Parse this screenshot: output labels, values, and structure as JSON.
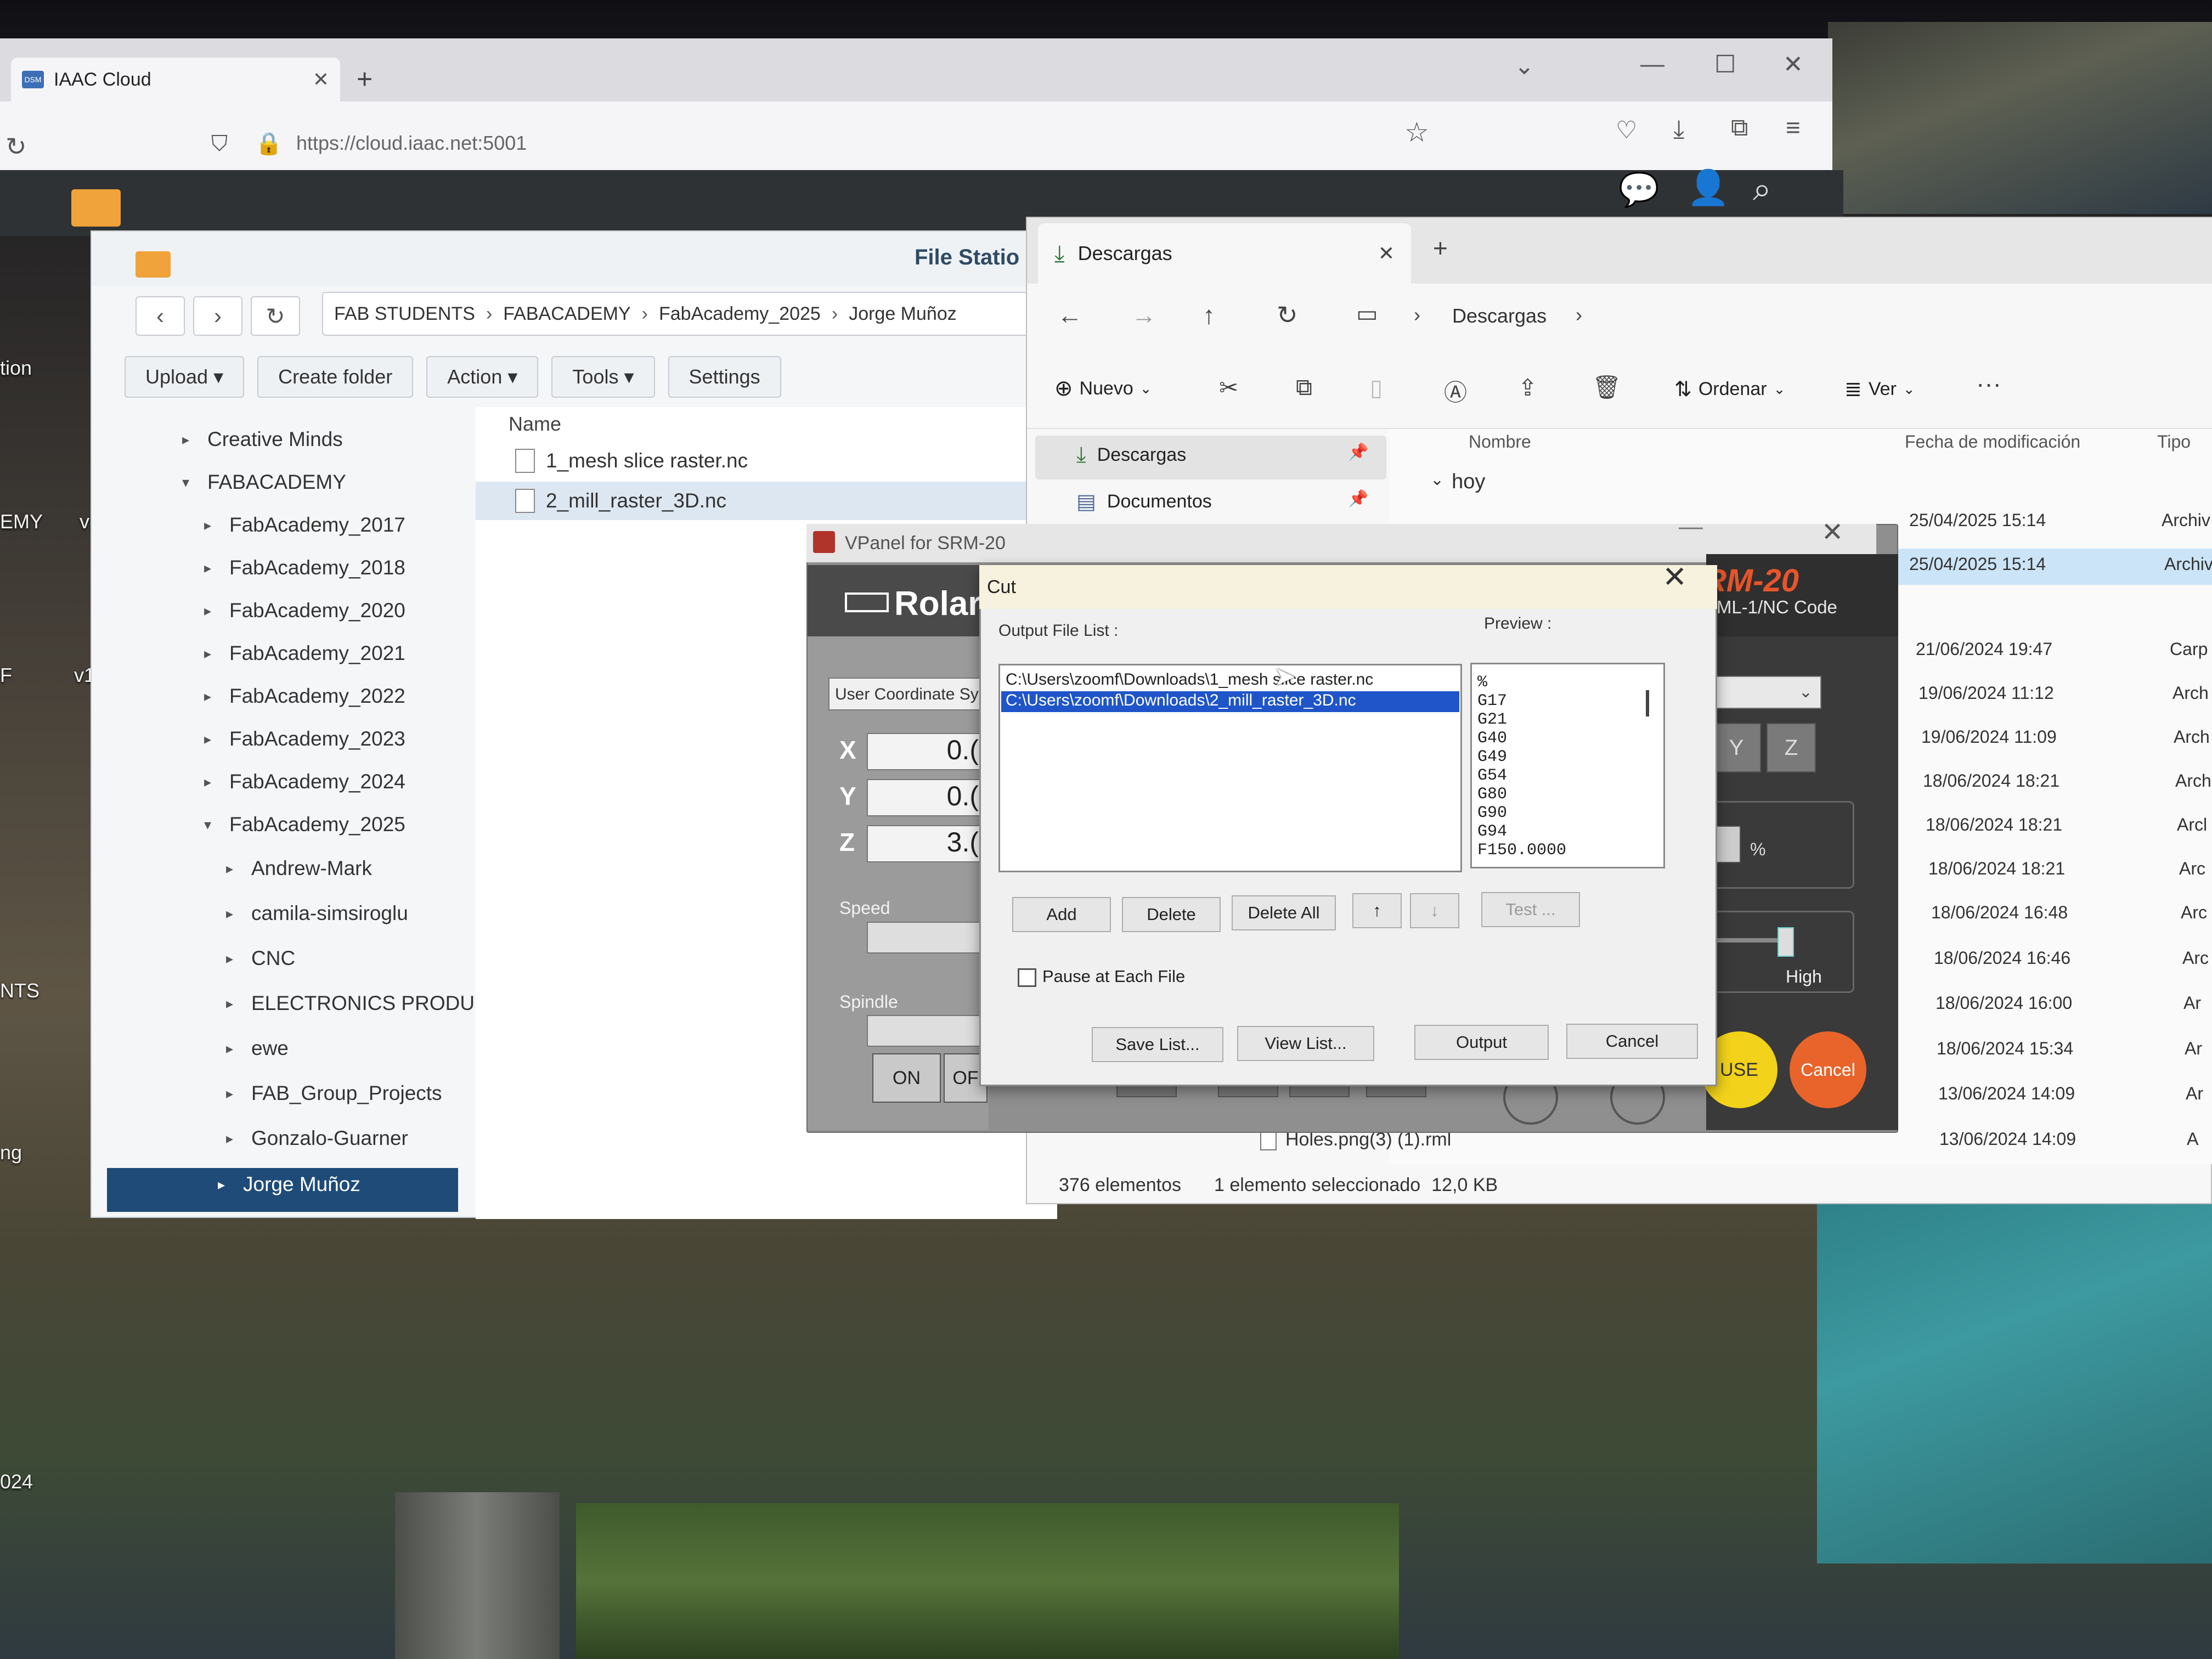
{
  "browser": {
    "tab_title": "IAAC Cloud",
    "tab_favicon": "DSM",
    "new_tab": "+",
    "url": "https://cloud.iaac.net:5001"
  },
  "desktop": {
    "labels": [
      "tion",
      "F",
      "EMY",
      "v1",
      "F",
      "v1",
      "NTS",
      "ng",
      "024"
    ]
  },
  "file_station": {
    "title": "File Statio",
    "breadcrumb": [
      "FAB STUDENTS",
      "FABACADEMY",
      "FabAcademy_2025",
      "Jorge Muñoz"
    ],
    "toolbar": {
      "upload": "Upload",
      "create_folder": "Create folder",
      "action": "Action",
      "tools": "Tools",
      "settings": "Settings"
    },
    "tree": [
      {
        "label": "Creative Minds"
      },
      {
        "label": "FABACADEMY"
      },
      {
        "label": "FabAcademy_2017"
      },
      {
        "label": "FabAcademy_2018"
      },
      {
        "label": "FabAcademy_2020"
      },
      {
        "label": "FabAcademy_2021"
      },
      {
        "label": "FabAcademy_2022"
      },
      {
        "label": "FabAcademy_2023"
      },
      {
        "label": "FabAcademy_2024"
      },
      {
        "label": "FabAcademy_2025"
      },
      {
        "label": "Andrew-Mark"
      },
      {
        "label": "camila-simsiroglu"
      },
      {
        "label": "CNC"
      },
      {
        "label": "ELECTRONICS PRODU"
      },
      {
        "label": "ewe"
      },
      {
        "label": "FAB_Group_Projects"
      },
      {
        "label": "Gonzalo-Guarner"
      },
      {
        "label": "Jorge Muñoz"
      }
    ],
    "list_header": "Name",
    "files": [
      "1_mesh slice raster.nc",
      "2_mill_raster_3D.nc"
    ]
  },
  "explorer": {
    "tab_title": "Descargas",
    "address": "Descargas",
    "commands": {
      "new": "Nuevo",
      "sort": "Ordenar",
      "view": "Ver",
      "more": "···"
    },
    "nav": [
      "Descargas",
      "Documentos"
    ],
    "columns": {
      "name": "Nombre",
      "date": "Fecha de modificación",
      "type": "Tipo"
    },
    "group": "hoy",
    "dates": [
      "25/04/2025 15:14",
      "25/04/2025 15:14",
      "21/06/2024 19:47",
      "19/06/2024 11:12",
      "19/06/2024 11:09",
      "18/06/2024 18:21",
      "18/06/2024 18:21",
      "18/06/2024 18:21",
      "18/06/2024 16:48",
      "18/06/2024 16:46",
      "18/06/2024 16:00",
      "18/06/2024 15:34",
      "13/06/2024 14:09",
      "13/06/2024 14:09"
    ],
    "types": [
      "Archiv",
      "Archiv",
      "Carp",
      "Arch",
      "Arch",
      "Arch",
      "Arcl",
      "Arc",
      "Arc",
      "Arc",
      "Ar",
      "Ar",
      "Ar",
      "A"
    ],
    "visible_file": "Holes.png(3) (1).rml",
    "status": {
      "count": "376 elementos",
      "selected": "1 elemento seleccionado",
      "size": "12,0 KB"
    }
  },
  "vpanel": {
    "title": "VPanel for SRM-20",
    "brand": "Rolar",
    "model": "RM-20",
    "code_mode": "RML-1/NC Code",
    "coord_system": "User Coordinate Sy",
    "axes": [
      {
        "label": "X",
        "value": "0.("
      },
      {
        "label": "Y",
        "value": "0.("
      },
      {
        "label": "Z",
        "value": "3.("
      }
    ],
    "speed_label": "Speed",
    "spindle_label": "Spindle",
    "on": "ON",
    "off": "OF",
    "axis_buttons": [
      "Y",
      "Z"
    ],
    "percent": "%",
    "high": "High",
    "pause": "USE",
    "cancel": "Cancel"
  },
  "cut_dialog": {
    "title": "Cut",
    "output_list_label": "Output File List :",
    "preview_label": "Preview :",
    "files": [
      "C:\\Users\\zoomf\\Downloads\\1_mesh slice raster.nc",
      "C:\\Users\\zoomf\\Downloads\\2_mill_raster_3D.nc"
    ],
    "preview_lines": [
      "%",
      "G17",
      "G21",
      "G40",
      "G49",
      "G54",
      "G80",
      "G90",
      "G94",
      "F150.0000"
    ],
    "buttons": {
      "add": "Add",
      "delete": "Delete",
      "delete_all": "Delete All",
      "up": "↑",
      "down": "↓",
      "test": "Test ...",
      "save_list": "Save List...",
      "view_list": "View List...",
      "output": "Output",
      "cancel": "Cancel"
    },
    "pause_label": "Pause at Each File"
  }
}
